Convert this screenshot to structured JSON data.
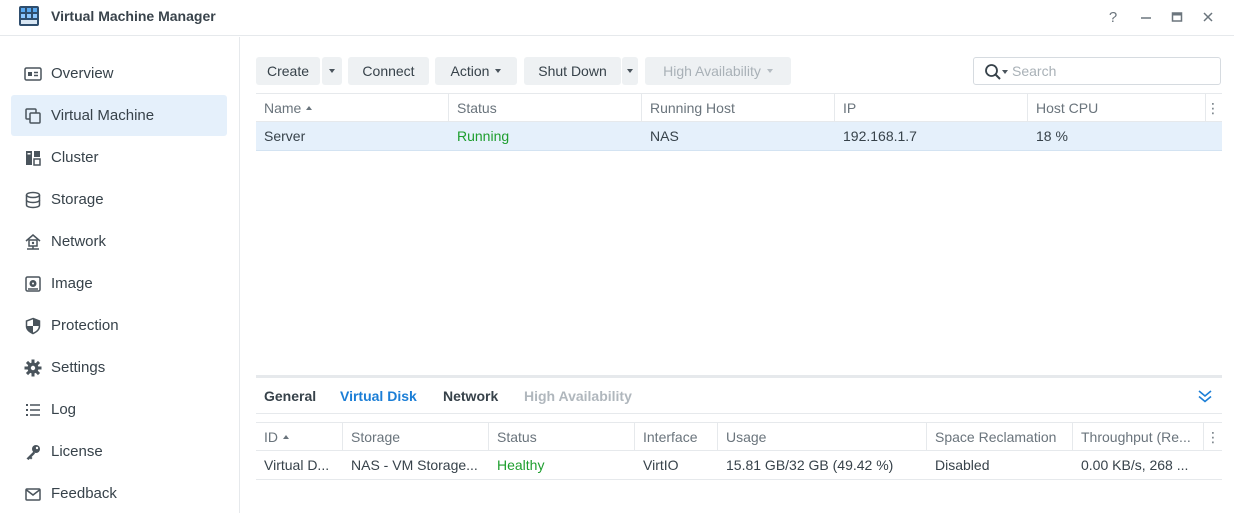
{
  "window": {
    "title": "Virtual Machine Manager",
    "controls": [
      "help-icon",
      "minimize-icon",
      "maximize-icon",
      "close-icon"
    ]
  },
  "sidebar": {
    "items": [
      {
        "label": "Overview",
        "icon": "overview-icon",
        "active": false
      },
      {
        "label": "Virtual Machine",
        "icon": "virtual-machine-icon",
        "active": true
      },
      {
        "label": "Cluster",
        "icon": "cluster-icon",
        "active": false
      },
      {
        "label": "Storage",
        "icon": "storage-icon",
        "active": false
      },
      {
        "label": "Network",
        "icon": "network-icon",
        "active": false
      },
      {
        "label": "Image",
        "icon": "image-icon",
        "active": false
      },
      {
        "label": "Protection",
        "icon": "shield-icon",
        "active": false
      },
      {
        "label": "Settings",
        "icon": "gear-icon",
        "active": false
      },
      {
        "label": "Log",
        "icon": "list-icon",
        "active": false
      },
      {
        "label": "License",
        "icon": "key-icon",
        "active": false
      },
      {
        "label": "Feedback",
        "icon": "mail-icon",
        "active": false
      }
    ]
  },
  "toolbar": {
    "create_label": "Create",
    "connect_label": "Connect",
    "action_label": "Action",
    "shutdown_label": "Shut Down",
    "ha_label": "High Availability"
  },
  "search": {
    "placeholder": "Search"
  },
  "vm_table": {
    "columns": [
      "Name",
      "Status",
      "Running Host",
      "IP",
      "Host CPU"
    ],
    "sort_column": "Name",
    "rows": [
      {
        "name": "Server",
        "status": "Running",
        "host": "NAS",
        "ip": "192.168.1.7",
        "cpu": "18 %"
      }
    ]
  },
  "detail": {
    "tabs": [
      {
        "label": "General",
        "state": "normal"
      },
      {
        "label": "Virtual Disk",
        "state": "active"
      },
      {
        "label": "Network",
        "state": "normal"
      },
      {
        "label": "High Availability",
        "state": "disabled"
      }
    ],
    "disk_table": {
      "columns": [
        "ID",
        "Storage",
        "Status",
        "Interface",
        "Usage",
        "Space Reclamation",
        "Throughput (Re..."
      ],
      "sort_column": "ID",
      "rows": [
        {
          "id": "Virtual D...",
          "storage": "NAS - VM Storage...",
          "status": "Healthy",
          "interface": "VirtIO",
          "usage": "15.81 GB/32 GB (49.42 %)",
          "reclamation": "Disabled",
          "throughput": "0.00 KB/s, 268 ..."
        }
      ]
    }
  },
  "colors": {
    "accent": "#1b7ed6",
    "selected_bg": "#e5f0fb",
    "healthy_green": "#1e9e2e",
    "button_bg": "#eef1f3"
  }
}
